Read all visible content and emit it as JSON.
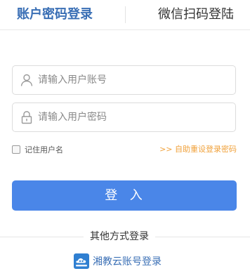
{
  "tabs": {
    "account_label": "账户密码登录",
    "wechat_label": "微信扫码登陆"
  },
  "form": {
    "username": {
      "value": "",
      "placeholder": "请输入用户账号",
      "icon": "user-icon"
    },
    "password": {
      "value": "",
      "placeholder": "请输入用户密码",
      "icon": "lock-icon"
    },
    "remember_label": "记住用户名",
    "remember_checked": false,
    "reset_link": ">> 自助重设登录密码",
    "submit_label": "登  入"
  },
  "other_login": {
    "title": "其他方式登录",
    "cloud_label": "湘教云账号登录",
    "cloud_icon": "xiangjiaoyun-logo-icon"
  },
  "colors": {
    "accent_blue": "#4a86e8",
    "tab_active": "#3a6fb5",
    "link_orange": "#f0a13a"
  }
}
